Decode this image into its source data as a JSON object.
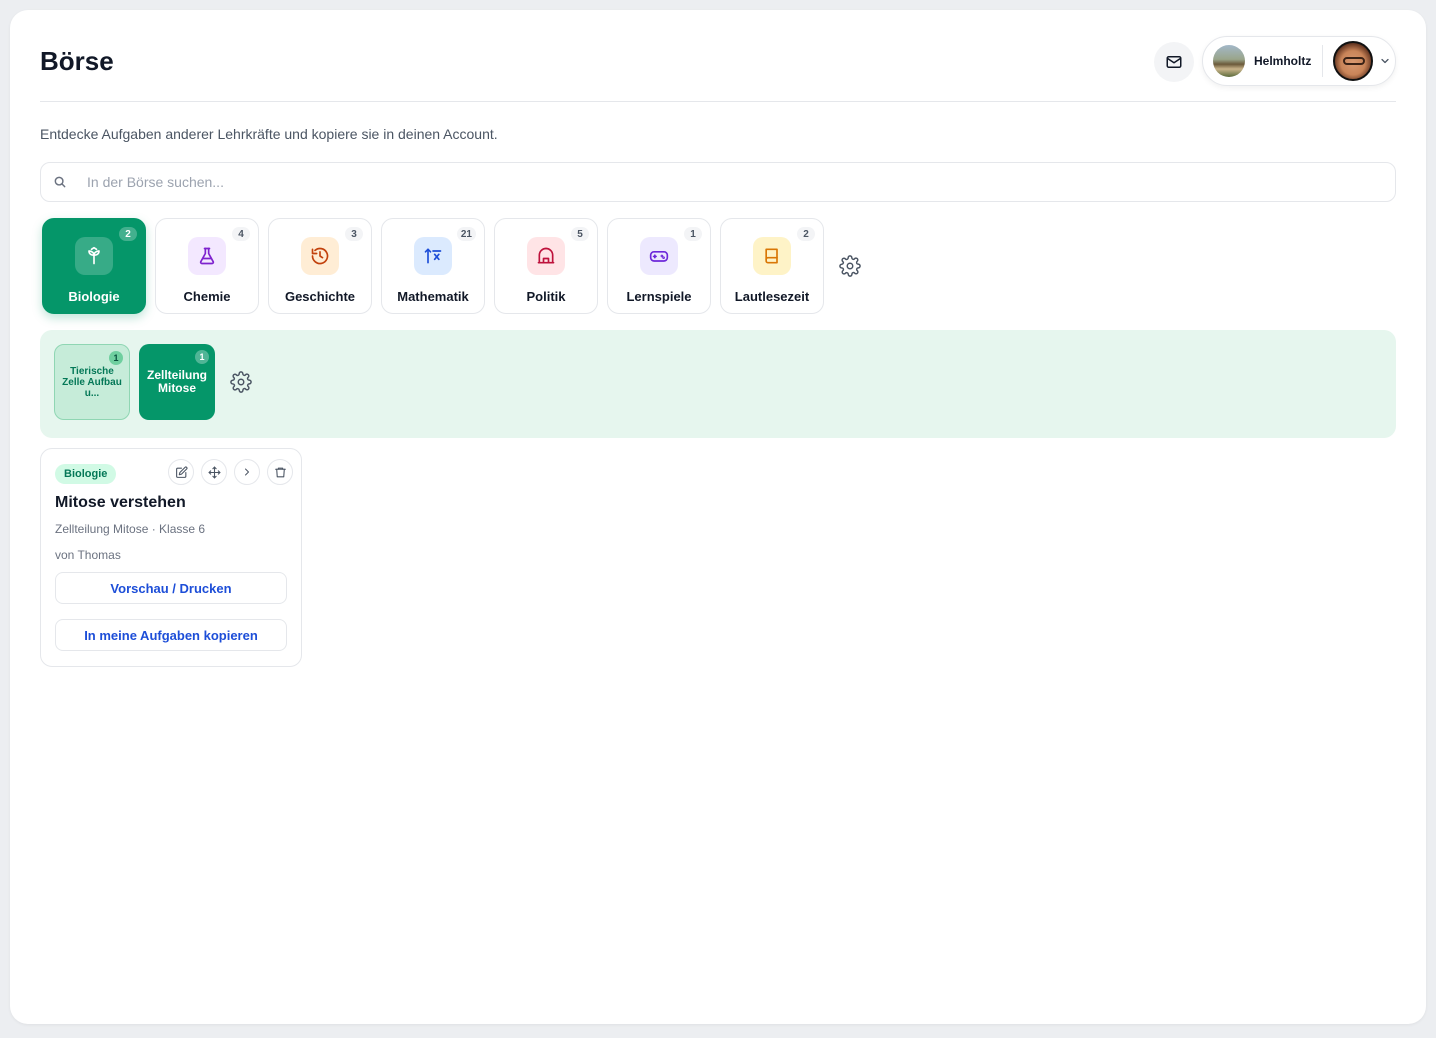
{
  "page": {
    "title": "Börse",
    "subtitle": "Entdecke Aufgaben anderer Lehrkräfte und kopiere sie in deinen Account."
  },
  "account": {
    "school_name": "Helmholtz"
  },
  "search": {
    "placeholder": "In der Börse suchen..."
  },
  "subjects": [
    {
      "label": "Biologie",
      "count": "2",
      "icon": "sprout-icon",
      "color": "#ffffff",
      "bg": "rgba(255,255,255,0.2)",
      "active": true
    },
    {
      "label": "Chemie",
      "count": "4",
      "icon": "flask-icon",
      "color": "#7e22ce",
      "bg": "#f3e8ff",
      "active": false
    },
    {
      "label": "Geschichte",
      "count": "3",
      "icon": "history-icon",
      "color": "#c2410c",
      "bg": "#ffedd5",
      "active": false
    },
    {
      "label": "Mathematik",
      "count": "21",
      "icon": "pi-icon",
      "color": "#1d4ed8",
      "bg": "#dbeafe",
      "active": false
    },
    {
      "label": "Politik",
      "count": "5",
      "icon": "parliament-icon",
      "color": "#be123c",
      "bg": "#ffe4e6",
      "active": false
    },
    {
      "label": "Lernspiele",
      "count": "1",
      "icon": "gamepad-icon",
      "color": "#6d28d9",
      "bg": "#ede9fe",
      "active": false
    },
    {
      "label": "Lautlesezeit",
      "count": "2",
      "icon": "book-icon",
      "color": "#d97706",
      "bg": "#fef3c7",
      "active": false
    }
  ],
  "topics": [
    {
      "label": "Tierische Zelle Aufbau u...",
      "count": "1",
      "active": false
    },
    {
      "label": "Zellteilung Mitose",
      "count": "1",
      "active": true
    }
  ],
  "card": {
    "badge": "Biologie",
    "title": "Mitose verstehen",
    "meta": "Zellteilung Mitose · Klasse 6",
    "author": "von Thomas",
    "preview_label": "Vorschau / Drucken",
    "copy_label": "In meine Aufgaben kopieren"
  },
  "colors": {
    "accent": "#059669",
    "link": "#1d4ed8",
    "topic_area_bg": "#e6f6ee"
  }
}
